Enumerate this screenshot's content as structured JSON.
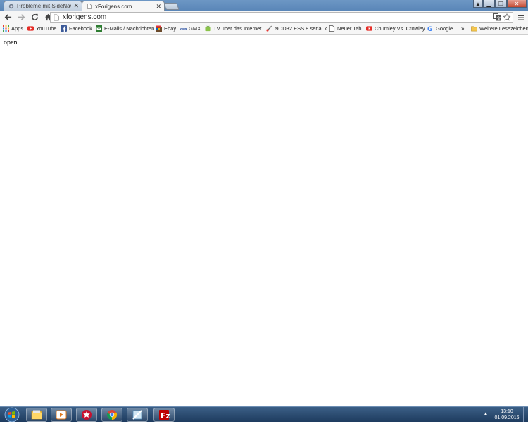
{
  "tabs": [
    {
      "title": "Probleme mit SideNav",
      "active": false
    },
    {
      "title": "xForigens.com",
      "active": true
    }
  ],
  "toolbar": {
    "back_icon": "back-arrow-icon",
    "forward_icon": "forward-arrow-icon",
    "reload_icon": "reload-icon",
    "home_icon": "home-icon",
    "url": "xforigens.com",
    "menu_icon": "hamburger-menu-icon"
  },
  "bookmarks": [
    {
      "label": "Apps",
      "icon": "apps-grid-icon"
    },
    {
      "label": "YouTube",
      "icon": "youtube-icon"
    },
    {
      "label": "Facebook",
      "icon": "facebook-icon"
    },
    {
      "label": "E-Mails / Nachrichten",
      "icon": "email-icon"
    },
    {
      "label": "Ebay",
      "icon": "ebay-icon"
    },
    {
      "label": "GMX",
      "icon": "gmx-icon"
    },
    {
      "label": "TV über das Internet.",
      "icon": "tv-icon"
    },
    {
      "label": "NOD32 ESS 8 serial k",
      "icon": "nod32-icon"
    },
    {
      "label": "Neuer Tab",
      "icon": "page-icon"
    },
    {
      "label": "Chumley Vs. Crowley",
      "icon": "youtube-icon"
    },
    {
      "label": "Google",
      "icon": "google-icon"
    },
    {
      "label": "»",
      "icon": "chevron-double-icon"
    },
    {
      "label": "Weitere Lesezeichen",
      "icon": "folder-icon"
    }
  ],
  "content": {
    "text": "open"
  },
  "taskbar": {
    "clock_time": "13:10",
    "clock_date": "01.09.2016",
    "items": [
      {
        "icon": "file-explorer-icon"
      },
      {
        "icon": "media-player-icon"
      },
      {
        "icon": "pokerstars-icon"
      },
      {
        "icon": "chrome-icon"
      },
      {
        "icon": "window-app-icon"
      },
      {
        "icon": "filezilla-icon"
      }
    ]
  },
  "colors": {
    "taskbar": "#1d3a5d",
    "titlebar": "#5a86b8",
    "youtube_red": "#e52d27",
    "facebook_blue": "#3b5998"
  }
}
